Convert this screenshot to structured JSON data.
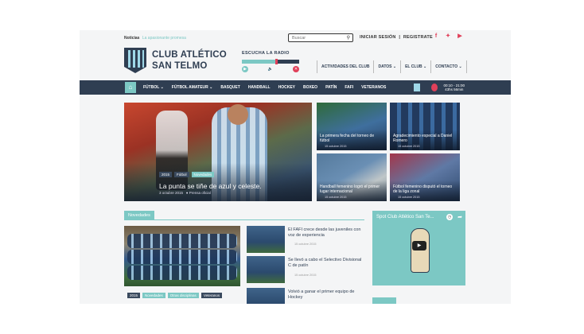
{
  "topbar": {
    "news_label": "Noticias",
    "news_text": "La apasionante promesa",
    "search_placeholder": "Buscar",
    "login": "INICIAR SESIÓN",
    "separator": "|",
    "register": "REGISTRATE",
    "social": [
      "f",
      "t",
      "yt"
    ]
  },
  "header": {
    "club_line1": "CLUB ATLÉTICO",
    "club_line2": "SAN TELMO",
    "radio_title": "ESCUCHA LA RADIO",
    "radio_progress": 0.6,
    "menu": [
      "ACTIVIDADES DEL CLUB",
      "DATOS ⌄",
      "EL CLUB ⌄",
      "CONTACTO ⌄"
    ]
  },
  "navbar": {
    "home_icon": "home-icon",
    "items": [
      "FÚTBOL ⌄",
      "FÚTBOL AMATEUR ⌄",
      "BASQUET",
      "HANDBALL",
      "HOCKEY",
      "BOXEO",
      "PATÍN",
      "FAFI",
      "VETERANOS"
    ],
    "time_line1": "00:10 - 21:00",
    "time_line2": "43hs 56min"
  },
  "hero": {
    "tags": [
      "2015",
      "Fútbol",
      "Novedades"
    ],
    "title": "La punta se tiñe de azul y celeste.",
    "date": "3 octubre 2015",
    "author": "Prensa oficial"
  },
  "thumbs": [
    {
      "title": "La primera fecha del torneo de fútbol",
      "date": "15 octubre 2015"
    },
    {
      "title": "Agradecimiento especial a Daniel Romero",
      "date": "15 octubre 2015"
    },
    {
      "title": "Handball femenino logró el primer lugar internacional",
      "date": "15 octubre 2015"
    },
    {
      "title": "Fútbol femenino disputó el torneo de la liga zonal",
      "date": "15 octubre 2015"
    }
  ],
  "novedades": {
    "label": "Novedades",
    "big_tags": [
      "2015",
      "Novedades",
      "Otras disciplinas",
      "Veteranos"
    ],
    "items": [
      {
        "title": "El FAFI crece desde las juveniles con voz de experiencia",
        "date": "15 octubre 2015"
      },
      {
        "title": "Se llevó a cabo el Selectivo Divisional C de patín",
        "date": "15 octubre 2015"
      },
      {
        "title": "Volvió a ganar el primer equipo de Hockey",
        "date": ""
      }
    ]
  },
  "video": {
    "title": "Spot Club Atlético San Te...",
    "clock_icon": "clock-icon",
    "share_icon": "share-icon"
  },
  "colors": {
    "navy": "#2f3e52",
    "teal": "#7cc8c4",
    "red": "#e0405a"
  }
}
